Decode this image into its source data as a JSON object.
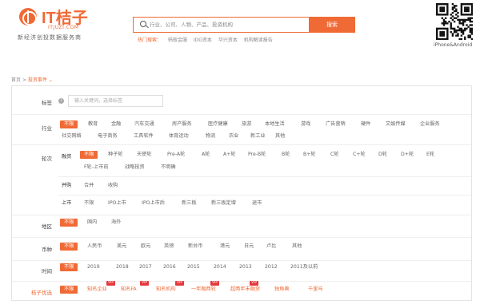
{
  "brand": {
    "logo_text": "IT桔子",
    "domain": "ITJUZI.COM",
    "slogan": "新经济创投数据服务商",
    "accent": "#f06a35"
  },
  "search": {
    "placeholder": "行业、公司、人物、产品、投资机构",
    "button_label": "搜索",
    "hot_label": "热门搜索：",
    "hot_items": [
      "蚂蚁金服",
      "IDG资本",
      "华兴资本",
      "机构解读报告"
    ]
  },
  "qr": {
    "caption": "iPhone&Android",
    "icon": "qr-code-icon"
  },
  "breadcrumb": {
    "home": "首页",
    "separator": ">",
    "current": "投资事件"
  },
  "filters": {
    "tag": {
      "label": "标签",
      "placeholder": "输入关键词，选择标签"
    },
    "industry": {
      "label": "行业",
      "options": [
        "不限",
        "教育",
        "金融",
        "汽车交通",
        "房产服务",
        "医疗健康",
        "旅游",
        "本地生活",
        "游戏",
        "广告营销",
        "硬件",
        "文娱传媒",
        "企业服务",
        "社交网络",
        "电子商务",
        "工具软件",
        "体育运动",
        "物流",
        "农业",
        "新工业",
        "其他"
      ],
      "selected": "不限"
    },
    "round": {
      "label": "轮次",
      "financing": {
        "label": "融资",
        "options": [
          "不限",
          "种子轮",
          "天使轮",
          "Pre-A轮",
          "A轮",
          "A+轮",
          "Pre-B轮",
          "B轮",
          "B+轮",
          "C轮",
          "C+轮",
          "D轮",
          "D+轮",
          "E轮",
          "F轮-上市前",
          "战略投资",
          "不明确"
        ],
        "selected": "不限"
      },
      "merger": {
        "label": "并购",
        "options": [
          "合并",
          "收购"
        ]
      },
      "listing": {
        "label": "上市",
        "options": [
          "不限",
          "IPO上市",
          "IPO上市后",
          "新三板",
          "新三板定增",
          "退市"
        ]
      }
    },
    "region": {
      "label": "地区",
      "options": [
        "不限",
        "国内",
        "海外"
      ],
      "selected": "不限"
    },
    "currency": {
      "label": "币种",
      "options": [
        "不限",
        "人民币",
        "美元",
        "欧元",
        "英镑",
        "新台币",
        "港元",
        "日元",
        "卢比",
        "其他"
      ],
      "selected": "不限"
    },
    "time": {
      "label": "时间",
      "options": [
        "不限",
        "2019",
        "2018",
        "2017",
        "2016",
        "2015",
        "2014",
        "2013",
        "2012",
        "2011及以前"
      ],
      "selected": "不限"
    },
    "juzi": {
      "label": "桔子优选",
      "options": [
        "不限",
        "知名企业",
        "知名FA",
        "知名机构",
        "一年融两轮",
        "超两年未融资",
        "独角兽",
        "千里马"
      ],
      "vip_badge": "VIP",
      "vip_flags": [
        false,
        true,
        true,
        true,
        true,
        true,
        false,
        false
      ],
      "selected": "不限"
    }
  }
}
